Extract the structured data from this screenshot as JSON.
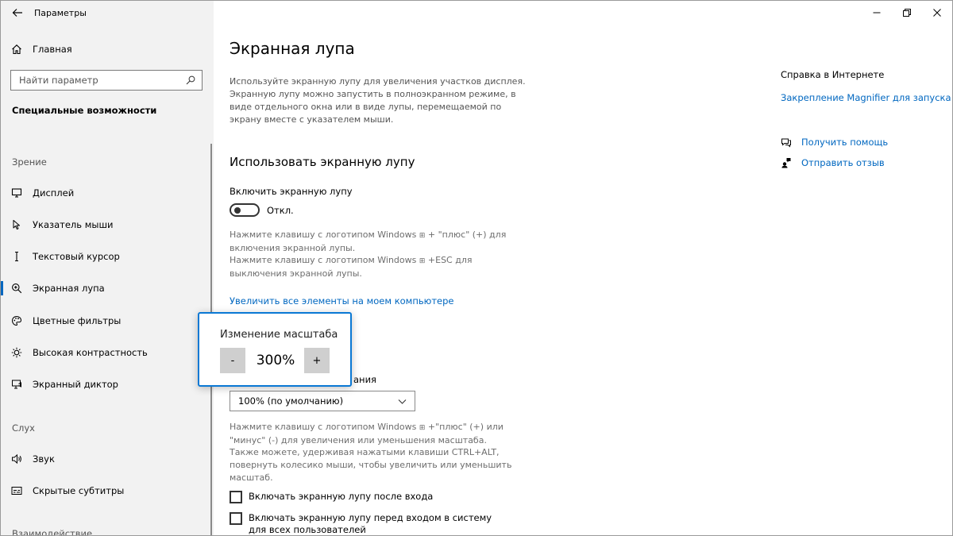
{
  "app": {
    "title": "Параметры"
  },
  "sidebar": {
    "home_label": "Главная",
    "search_placeholder": "Найти параметр",
    "category": "Специальные возможности",
    "groups": {
      "vision": "Зрение",
      "hearing": "Слух",
      "interaction": "Взаимодействие"
    },
    "items": [
      {
        "label": "Дисплей",
        "icon": "monitor-icon"
      },
      {
        "label": "Указатель мыши",
        "icon": "mouse-pointer-icon"
      },
      {
        "label": "Текстовый курсор",
        "icon": "text-cursor-icon"
      },
      {
        "label": "Экранная лупа",
        "icon": "magnifier-icon",
        "active": true
      },
      {
        "label": "Цветные фильтры",
        "icon": "palette-icon"
      },
      {
        "label": "Высокая контрастность",
        "icon": "brightness-icon"
      },
      {
        "label": "Экранный диктор",
        "icon": "narrator-icon"
      },
      {
        "label": "Звук",
        "icon": "speaker-icon"
      },
      {
        "label": "Скрытые субтитры",
        "icon": "captions-icon"
      }
    ]
  },
  "main": {
    "title": "Экранная лупа",
    "description": "Используйте экранную лупу для увеличения участков дисплея. Экранную лупу можно запустить в полноэкранном режиме, в виде отдельного окна или в виде лупы, перемещаемой по экрану вместе с указателем мыши.",
    "section_title": "Использовать экранную лупу",
    "toggle_label": "Включить экранную лупу",
    "toggle_state": "Откл.",
    "hint_on_1": "Нажмите клавишу с логотипом Windows",
    "hint_on_2": "+ \"плюс\" (+) для включения экранной лупы.",
    "hint_off_1": "Нажмите клавишу с логотипом Windows",
    "hint_off_2": "+ESC для выключения экранной лупы.",
    "link_label": "Увеличить все элементы на моем компьютере",
    "zoom_level_label_partial": "ания",
    "dropdown_value": "100% (по умолчанию)",
    "zoom_hint_1": "Нажмите клавишу с логотипом Windows",
    "zoom_hint_2": "+\"плюс\" (+) или \"минус\" (-) для увеличения или уменьшения масштаба.",
    "zoom_hint_3": "Также можете, удерживая нажатыми клавиши CTRL+ALT, повернуть колесико мыши, чтобы увеличить или уменьшить масштаб.",
    "checkbox_1": "Включать экранную лупу после входа",
    "checkbox_2": "Включать экранную лупу перед входом в систему для всех пользователей"
  },
  "rail": {
    "heading": "Справка в Интернете",
    "link": "Закрепление Magnifier для запуска",
    "get_help": "Получить помощь",
    "feedback": "Отправить отзыв"
  },
  "zoom_panel": {
    "title": "Изменение масштаба",
    "minus": "-",
    "value": "300%",
    "plus": "+"
  },
  "colors": {
    "accent": "#0067c0",
    "panel_border": "#0a78d4",
    "sidebar_bg": "#f2f2f2"
  }
}
